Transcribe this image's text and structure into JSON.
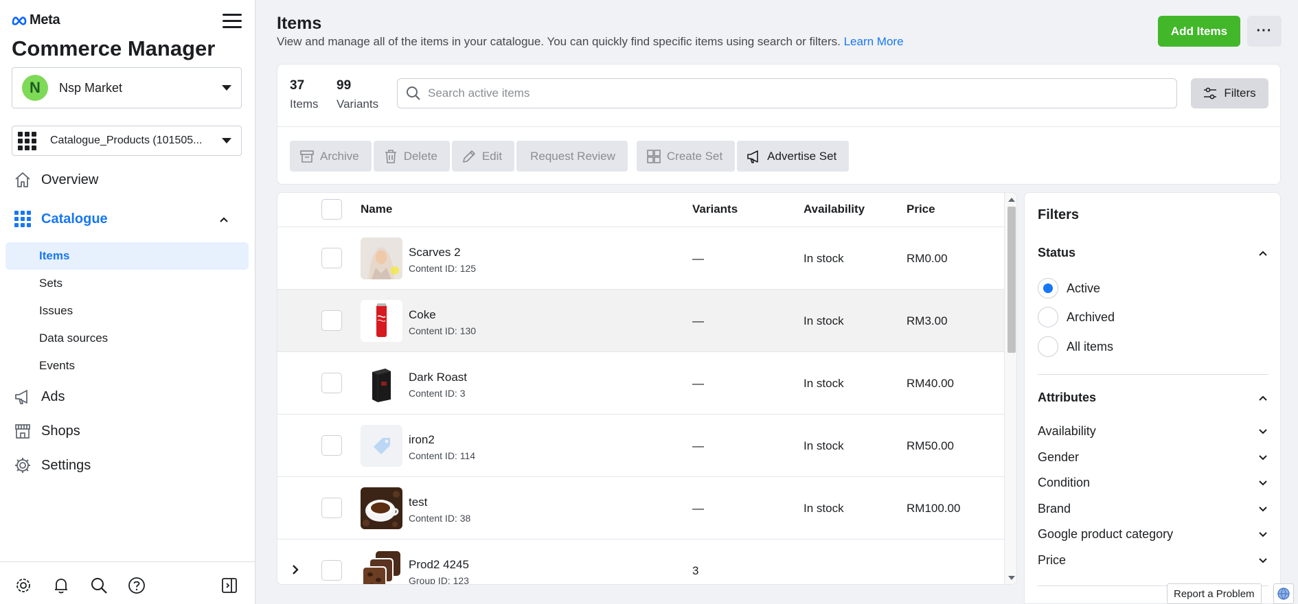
{
  "brand": {
    "logo_text": "Meta",
    "app_title": "Commerce Manager"
  },
  "account": {
    "initial": "N",
    "name": "Nsp Market"
  },
  "catalogue_select": {
    "name": "Catalogue_Products (101505..."
  },
  "nav": {
    "overview": "Overview",
    "catalogue": "Catalogue",
    "sub_items": [
      "Items",
      "Sets",
      "Issues",
      "Data sources",
      "Events"
    ],
    "ads": "Ads",
    "shops": "Shops",
    "settings": "Settings"
  },
  "header": {
    "title": "Items",
    "description": "View and manage all of the items in your catalogue. You can quickly find specific items using search or filters.",
    "learn_more": "Learn More",
    "add_button": "Add Items",
    "more_button": "···"
  },
  "summary": {
    "items_count": "37",
    "items_label": "Items",
    "variants_count": "99",
    "variants_label": "Variants"
  },
  "search": {
    "placeholder": "Search active items"
  },
  "filters_button": "Filters",
  "toolbar": {
    "archive": "Archive",
    "delete": "Delete",
    "edit": "Edit",
    "request_review": "Request Review",
    "create_set": "Create Set",
    "advertise_set": "Advertise Set"
  },
  "table": {
    "columns": {
      "name": "Name",
      "variants": "Variants",
      "availability": "Availability",
      "price": "Price"
    },
    "rows": [
      {
        "name": "Scarves 2",
        "id_label": "Content ID: 125",
        "variants": "—",
        "availability": "In stock",
        "price": "RM0.00"
      },
      {
        "name": "Coke",
        "id_label": "Content ID: 130",
        "variants": "—",
        "availability": "In stock",
        "price": "RM3.00"
      },
      {
        "name": "Dark Roast",
        "id_label": "Content ID: 3",
        "variants": "—",
        "availability": "In stock",
        "price": "RM40.00"
      },
      {
        "name": "iron2",
        "id_label": "Content ID: 114",
        "variants": "—",
        "availability": "In stock",
        "price": "RM50.00"
      },
      {
        "name": "test",
        "id_label": "Content ID: 38",
        "variants": "—",
        "availability": "In stock",
        "price": "RM100.00"
      },
      {
        "name": "Prod2 4245",
        "id_label": "Group ID: 123",
        "variants": "3",
        "availability": "",
        "price": ""
      }
    ]
  },
  "filter_panel": {
    "title": "Filters",
    "status_title": "Status",
    "status_options": [
      "Active",
      "Archived",
      "All items"
    ],
    "selected_status": "Active",
    "attributes_title": "Attributes",
    "attributes": [
      "Availability",
      "Gender",
      "Condition",
      "Brand",
      "Google product category",
      "Price"
    ]
  },
  "footer": {
    "report_problem": "Report a Problem"
  },
  "colors": {
    "accent": "#1877f2",
    "add_button": "#42b72a",
    "active_nav_bg": "#e7f0fd"
  },
  "icons": {
    "nav": [
      "home-icon",
      "grid-icon",
      "megaphone-icon",
      "shop-icon",
      "gear-icon"
    ],
    "footer": [
      "gear-icon",
      "bell-icon",
      "search-icon",
      "help-icon",
      "panel-toggle-icon"
    ]
  }
}
